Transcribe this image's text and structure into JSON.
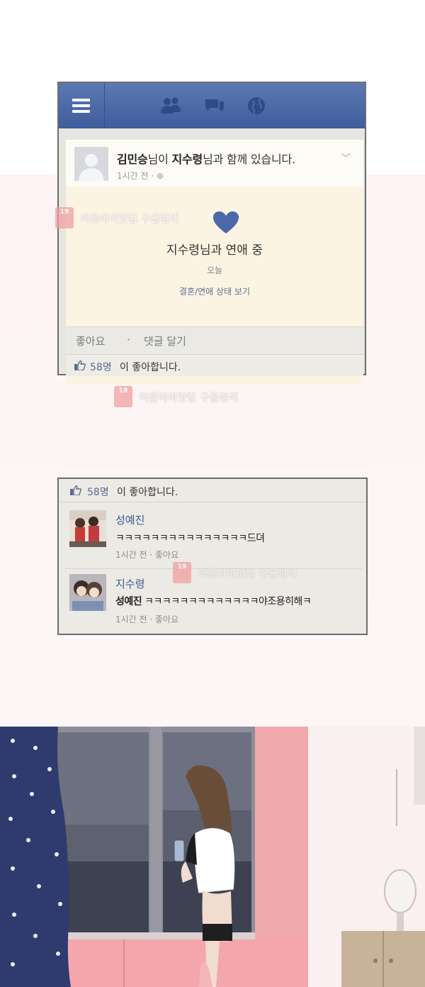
{
  "post": {
    "author_name": "김민승",
    "connector_1": "님이 ",
    "tagged_name": "지수령",
    "connector_2": "님과 함께 있습니다.",
    "time": "1시간 전",
    "privacy_sep": " · ",
    "privacy_icon": "globe-small-icon",
    "relationship_title": "지수령님과 연애 중",
    "relationship_date": "오늘",
    "relationship_link": "결혼/연애 상태 보기",
    "like_action": "좋아요",
    "action_sep": "·",
    "comment_action": "댓글 달기",
    "like_count": "58명",
    "like_suffix": "이 좋아합니다."
  },
  "nav_icons": [
    "menu-icon",
    "friends-icon",
    "messages-icon",
    "globe-icon"
  ],
  "comments_panel": {
    "like_count": "58명",
    "like_suffix": "이 좋아합니다.",
    "comments": [
      {
        "name": "성예진",
        "text": "ㅋㅋㅋㅋㅋㅋㅋㅋㅋㅋㅋㅋㅋㅋㅋ드뎌",
        "meta": "1시간 전 · 좋아요"
      },
      {
        "name": "지수령",
        "mention": "성예진",
        "text": " ㅋㅋㅋㅋㅋㅋㅋㅋㅋㅋㅋㅋㅋ야조용히해ㅋ",
        "meta": "1시간 전 · 좋아요"
      }
    ]
  },
  "watermark": {
    "badge": "19",
    "text": "어른아이닷컴 구글검색"
  },
  "colors": {
    "facebook_bar": "#4a67a6",
    "story_bg": "#fcf4e3",
    "link_blue": "#3b5998",
    "heart": "#4d68a8",
    "curtain": "#2f3b6e",
    "wall_pink": "#f1a7ac"
  }
}
